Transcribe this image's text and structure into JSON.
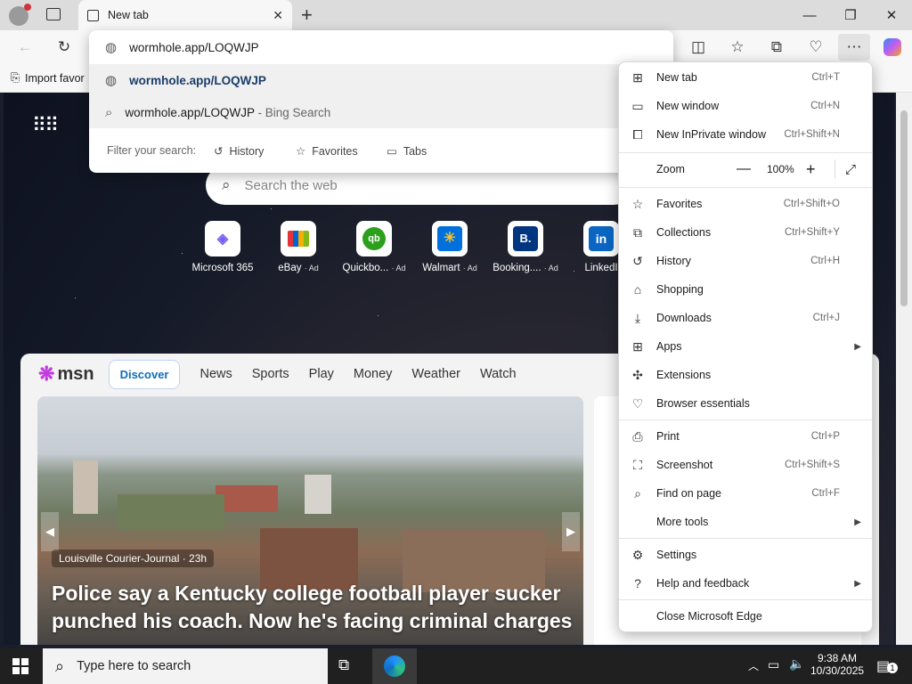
{
  "browser": {
    "tab_title": "New tab",
    "address_value": "wormhole.app/LOQWJP",
    "favorites_bar_item": "Import favor"
  },
  "omnibox": {
    "suggestion_url": "wormhole.app/LOQWJP",
    "suggestion_search": "wormhole.app/LOQWJP",
    "suggestion_search_suffix": " - Bing Search",
    "filter_label": "Filter your search:",
    "filters": [
      "History",
      "Favorites",
      "Tabs"
    ]
  },
  "newtab": {
    "search_placeholder": "Search the web",
    "shortcuts": [
      {
        "label": "Microsoft 365",
        "ad": ""
      },
      {
        "label": "eBay",
        "ad": "· Ad"
      },
      {
        "label": "Quickbo...",
        "ad": "· Ad"
      },
      {
        "label": "Walmart",
        "ad": "· Ad"
      },
      {
        "label": "Booking....",
        "ad": "· Ad"
      },
      {
        "label": "LinkedI",
        "ad": ""
      }
    ]
  },
  "msn": {
    "logo": "msn",
    "tabs": [
      "Discover",
      "News",
      "Sports",
      "Play",
      "Money",
      "Weather",
      "Watch"
    ],
    "hero_source": "Louisville Courier-Journal · 23h",
    "hero_title": "Police say a Kentucky college football player sucker punched his coach. Now he's facing criminal charges"
  },
  "menu": {
    "items": [
      {
        "label": "New tab",
        "shortcut": "Ctrl+T",
        "icon": "new-tab-icon"
      },
      {
        "label": "New window",
        "shortcut": "Ctrl+N",
        "icon": "window-icon"
      },
      {
        "label": "New InPrivate window",
        "shortcut": "Ctrl+Shift+N",
        "icon": "inprivate-icon"
      },
      {
        "label": "Favorites",
        "shortcut": "Ctrl+Shift+O",
        "icon": "star-icon"
      },
      {
        "label": "Collections",
        "shortcut": "Ctrl+Shift+Y",
        "icon": "collections-icon"
      },
      {
        "label": "History",
        "shortcut": "Ctrl+H",
        "icon": "history-icon"
      },
      {
        "label": "Shopping",
        "shortcut": "",
        "icon": "tag-icon"
      },
      {
        "label": "Downloads",
        "shortcut": "Ctrl+J",
        "icon": "download-icon"
      },
      {
        "label": "Apps",
        "shortcut": "",
        "icon": "apps-icon"
      },
      {
        "label": "Extensions",
        "shortcut": "",
        "icon": "puzzle-icon"
      },
      {
        "label": "Browser essentials",
        "shortcut": "",
        "icon": "heart-icon"
      },
      {
        "label": "Print",
        "shortcut": "Ctrl+P",
        "icon": "print-icon"
      },
      {
        "label": "Screenshot",
        "shortcut": "Ctrl+Shift+S",
        "icon": "screenshot-icon"
      },
      {
        "label": "Find on page",
        "shortcut": "Ctrl+F",
        "icon": "find-icon"
      },
      {
        "label": "More tools",
        "shortcut": "",
        "icon": ""
      },
      {
        "label": "Settings",
        "shortcut": "",
        "icon": "gear-icon"
      },
      {
        "label": "Help and feedback",
        "shortcut": "",
        "icon": "help-icon"
      },
      {
        "label": "Close Microsoft Edge",
        "shortcut": "",
        "icon": ""
      }
    ],
    "zoom_label": "Zoom",
    "zoom_value": "100%"
  },
  "taskbar": {
    "search_placeholder": "Type here to search",
    "time": "9:38 AM",
    "date": "10/30/2025",
    "notification_count": "1"
  }
}
